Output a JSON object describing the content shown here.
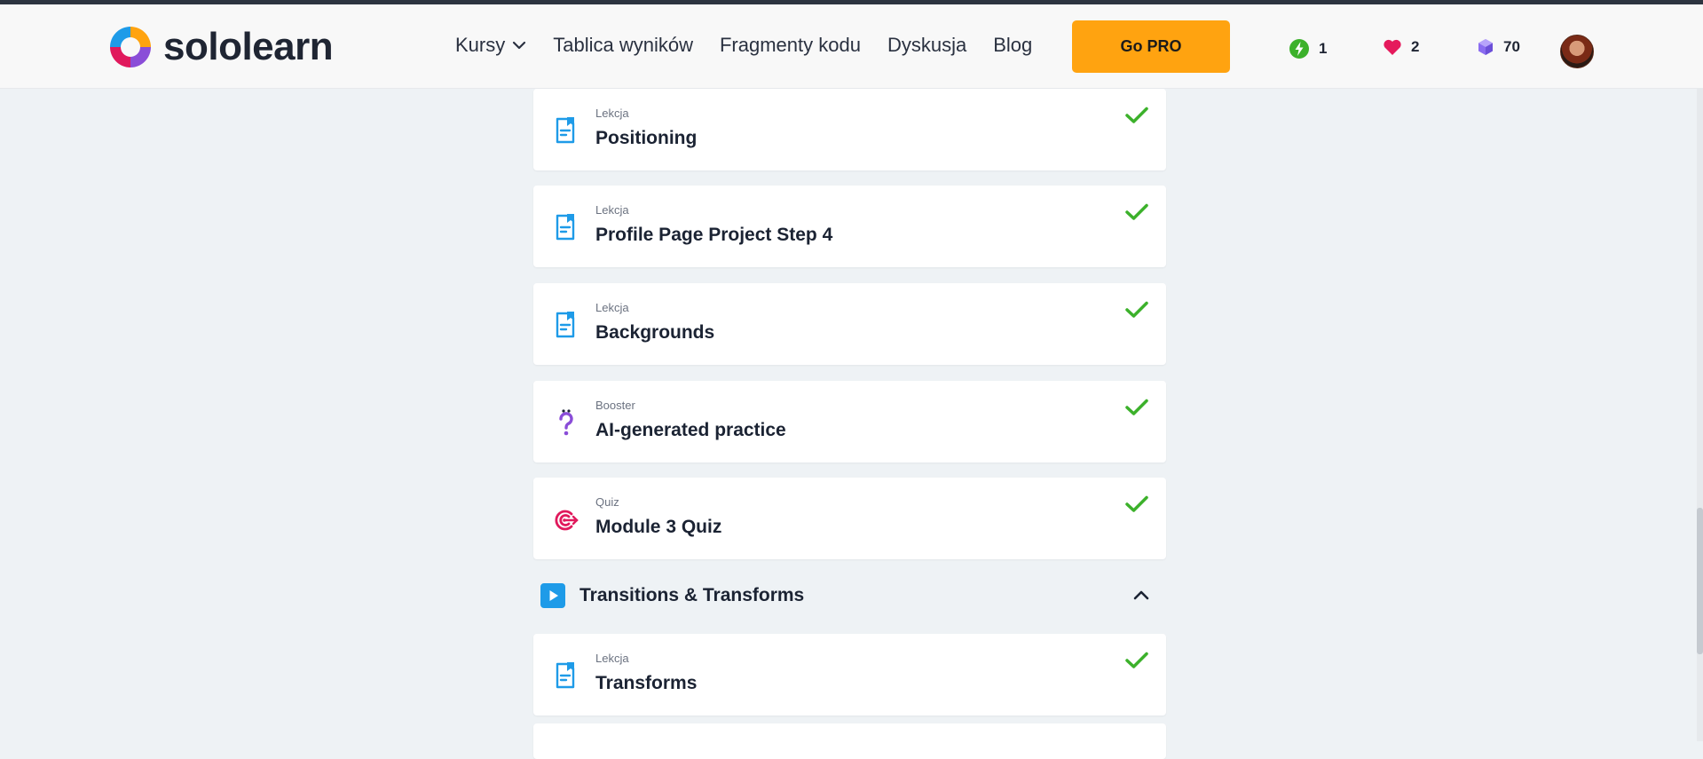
{
  "brand": {
    "name": "sololearn"
  },
  "nav": {
    "items": [
      {
        "label": "Kursy",
        "dropdown": true
      },
      {
        "label": "Tablica wyników"
      },
      {
        "label": "Fragmenty kodu"
      },
      {
        "label": "Dyskusja"
      },
      {
        "label": "Blog"
      }
    ],
    "go_pro_label": "Go PRO"
  },
  "stats": {
    "streak": {
      "value": "1",
      "icon": "lightning-icon",
      "color": "#3cb12b"
    },
    "hearts": {
      "value": "2",
      "icon": "heart-icon",
      "color": "#e51a5c"
    },
    "gems": {
      "value": "70",
      "icon": "gem-icon",
      "color": "#8a6cf0"
    }
  },
  "lessons": [
    {
      "kind": "Lekcja",
      "title": "Positioning",
      "icon": "lesson-icon",
      "completed": true
    },
    {
      "kind": "Lekcja",
      "title": "Profile Page Project Step 4",
      "icon": "lesson-icon",
      "completed": true
    },
    {
      "kind": "Lekcja",
      "title": "Backgrounds",
      "icon": "lesson-icon",
      "completed": true
    },
    {
      "kind": "Booster",
      "title": "AI-generated practice",
      "icon": "booster-icon",
      "completed": true
    },
    {
      "kind": "Quiz",
      "title": "Module 3 Quiz",
      "icon": "quiz-target-icon",
      "completed": true
    }
  ],
  "section": {
    "title": "Transitions & Transforms",
    "icon": "play-icon",
    "expanded": true
  },
  "section_lessons": [
    {
      "kind": "Lekcja",
      "title": "Transforms",
      "icon": "lesson-icon",
      "completed": true
    }
  ],
  "colors": {
    "accent_orange": "#ffa310",
    "check_green": "#3cb12b",
    "lesson_blue": "#1e9be8",
    "booster_purple": "#8a4dd8",
    "quiz_pink": "#e0195c"
  }
}
